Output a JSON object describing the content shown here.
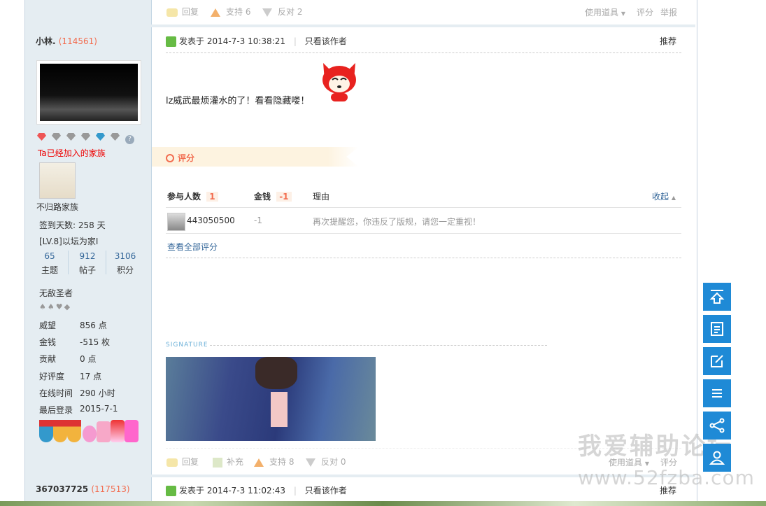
{
  "prev_post_actions": {
    "reply": "回复",
    "support": "支持 6",
    "oppose": "反对 2",
    "use_tool": "使用道具",
    "rate": "评分",
    "report": "举报"
  },
  "post1": {
    "author": {
      "name": "小林.",
      "uid": "(114561)"
    },
    "medals_label": "Ta已经加入的家族",
    "family": "不归路家族",
    "checkin": "签到天数: 258 天",
    "level": "[LV.8]以坛为家I",
    "stats": [
      {
        "num": "65",
        "label": "主题"
      },
      {
        "num": "912",
        "label": "帖子"
      },
      {
        "num": "3106",
        "label": "积分"
      }
    ],
    "title_rank": "无敌圣者",
    "suits": "♠♠♥◆",
    "profile": [
      {
        "label": "威望",
        "value": "856 点"
      },
      {
        "label": "金钱",
        "value": "-515 枚"
      },
      {
        "label": "贡献",
        "value": "0 点"
      },
      {
        "label": "好评度",
        "value": "17 点"
      },
      {
        "label": "在线时间",
        "value": "290 小时"
      },
      {
        "label": "最后登录",
        "value": "2015-7-1"
      }
    ],
    "posted_at": "发表于 2014-7-3 10:38:21",
    "only_author": "只看该作者",
    "recommend": "推荐",
    "content": "lz威武最烦灌水的了！看看隐藏喽！",
    "rating": {
      "section_title": "评分",
      "col_participants": "参与人数",
      "participants_count": "1",
      "col_money": "金钱",
      "money_total": "-1",
      "col_reason": "理由",
      "collapse": "收起",
      "rows": [
        {
          "user": "443050500",
          "money": "-1",
          "reason": "再次提醒您，你违反了版规，请您一定重视！"
        }
      ],
      "view_all": "查看全部评分"
    },
    "signature_label": "SIGNATURE",
    "actions": {
      "reply": "回复",
      "supplement": "补充",
      "support": "支持 8",
      "oppose": "反对 0",
      "use_tool": "使用道具",
      "rate": "评分"
    }
  },
  "post2": {
    "author": {
      "name": "367037725",
      "uid": "(117513)"
    },
    "posted_at": "发表于 2014-7-3 11:02:43",
    "only_author": "只看该作者",
    "recommend": "推荐"
  },
  "watermark": {
    "line1": "我爱辅助论坛",
    "line2": "www.52fzba.com"
  },
  "side_buttons": [
    "back-to-top-icon",
    "post-list-icon",
    "edit-icon",
    "menu-icon",
    "share-icon",
    "user-icon"
  ],
  "colors": {
    "accent_blue": "#1f8ad6",
    "link": "#336699",
    "rating_red": "#f26c4f",
    "sidebar_bg": "#e5edf2"
  }
}
